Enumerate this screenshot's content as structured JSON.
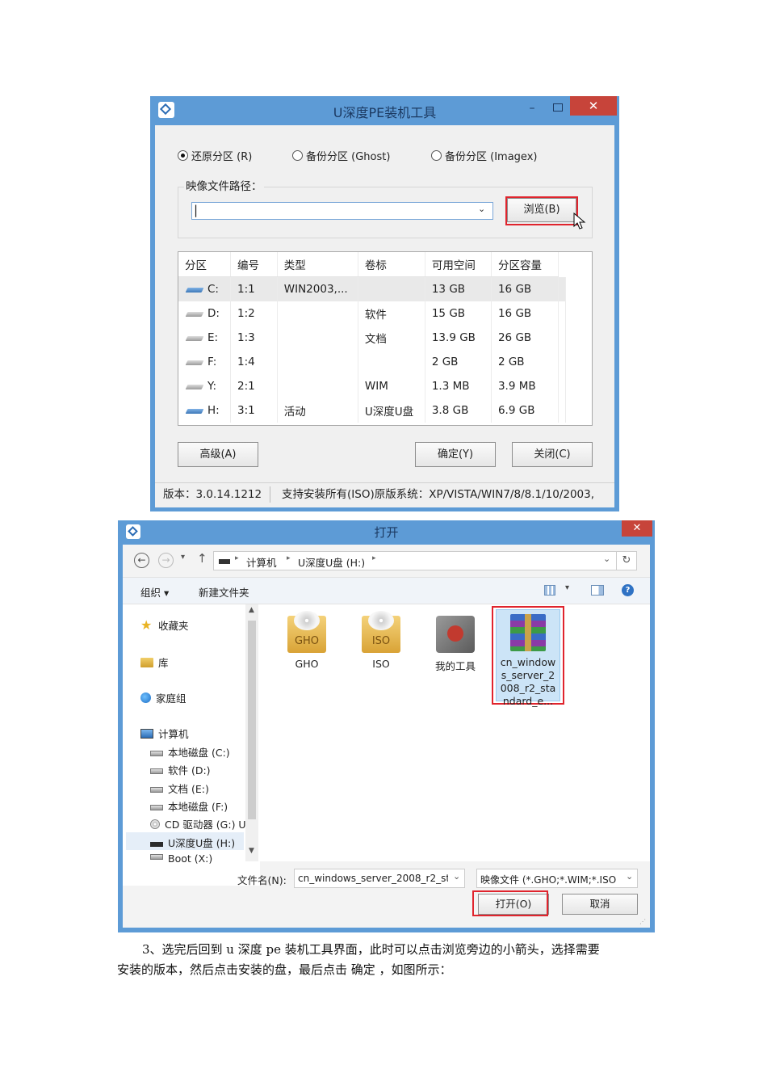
{
  "pe_tool": {
    "title": "U深度PE装机工具",
    "minimize_glyph": "–",
    "close_glyph": "✕",
    "radios": [
      {
        "label": "还原分区 (R)",
        "checked": true
      },
      {
        "label": "备份分区 (Ghost)",
        "checked": false
      },
      {
        "label": "备份分区 (Imagex)",
        "checked": false
      }
    ],
    "image_path_label": "映像文件路径：",
    "image_path_value": "|",
    "browse_label": "浏览(B)",
    "table": {
      "headers": [
        "分区",
        "编号",
        "类型",
        "卷标",
        "可用空间",
        "分区容量"
      ],
      "rows": [
        {
          "part": "C:",
          "num": "1:1",
          "type": "WIN2003,...",
          "label": "",
          "free": "13 GB",
          "size": "16 GB",
          "selected": true,
          "usb": true
        },
        {
          "part": "D:",
          "num": "1:2",
          "type": "",
          "label": "软件",
          "free": "15 GB",
          "size": "16 GB"
        },
        {
          "part": "E:",
          "num": "1:3",
          "type": "",
          "label": "文档",
          "free": "13.9 GB",
          "size": "26 GB"
        },
        {
          "part": "F:",
          "num": "1:4",
          "type": "",
          "label": "",
          "free": "2 GB",
          "size": "2 GB"
        },
        {
          "part": "Y:",
          "num": "2:1",
          "type": "",
          "label": "WIM",
          "free": "1.3 MB",
          "size": "3.9 MB"
        },
        {
          "part": "H:",
          "num": "3:1",
          "type": "活动",
          "label": "U深度U盘",
          "free": "3.8 GB",
          "size": "6.9 GB",
          "usb": true
        }
      ]
    },
    "advanced_label": "高级(A)",
    "ok_label": "确定(Y)",
    "close_label": "关闭(C)",
    "version": "版本：3.0.14.1212",
    "support_text": "支持安装所有(ISO)原版系统：XP/VISTA/WIN7/8/8.1/10/2003,"
  },
  "open_dialog": {
    "title": "打开",
    "close_glyph": "✕",
    "breadcrumb": [
      "计算机",
      "U深度U盘 (H:)"
    ],
    "toolbar": {
      "organize": "组织 ▾",
      "new_folder": "新建文件夹"
    },
    "nav": {
      "favorites": "收藏夹",
      "libraries": "库",
      "homegroup": "家庭组",
      "computer": "计算机",
      "drives": [
        "本地磁盘 (C:)",
        "软件 (D:)",
        "文档 (E:)",
        "本地磁盘 (F:)",
        "CD 驱动器 (G:) U",
        "U深度U盘 (H:)",
        "Boot (X:)"
      ]
    },
    "files": [
      {
        "name": "GHO",
        "icon_text": "GHO"
      },
      {
        "name": "ISO",
        "icon_text": "ISO"
      },
      {
        "name": "我的工具"
      },
      {
        "name_lines": [
          "cn_window",
          "s_server_2",
          "008_r2_sta",
          "ndard_e..."
        ]
      }
    ],
    "filename_label": "文件名(N):",
    "filename_value": "cn_windows_server_2008_r2_st",
    "filter_value": "映像文件 (*.GHO;*.WIM;*.ISO",
    "open_label": "打开(O)",
    "cancel_label": "取消"
  },
  "document": {
    "paragraph_line1": "3、选完后回到 u 深度 pe 装机工具界面，此时可以点击浏览旁边的小箭头，选择需要",
    "paragraph_line2": "安装的版本，然后点击安装的盘，最后点击 确定 ，如图所示："
  },
  "colors": {
    "window_frame": "#5d9bd6",
    "close_red": "#c7443a",
    "highlight_red": "#e0242d",
    "selection_blue": "#cce4f7"
  }
}
